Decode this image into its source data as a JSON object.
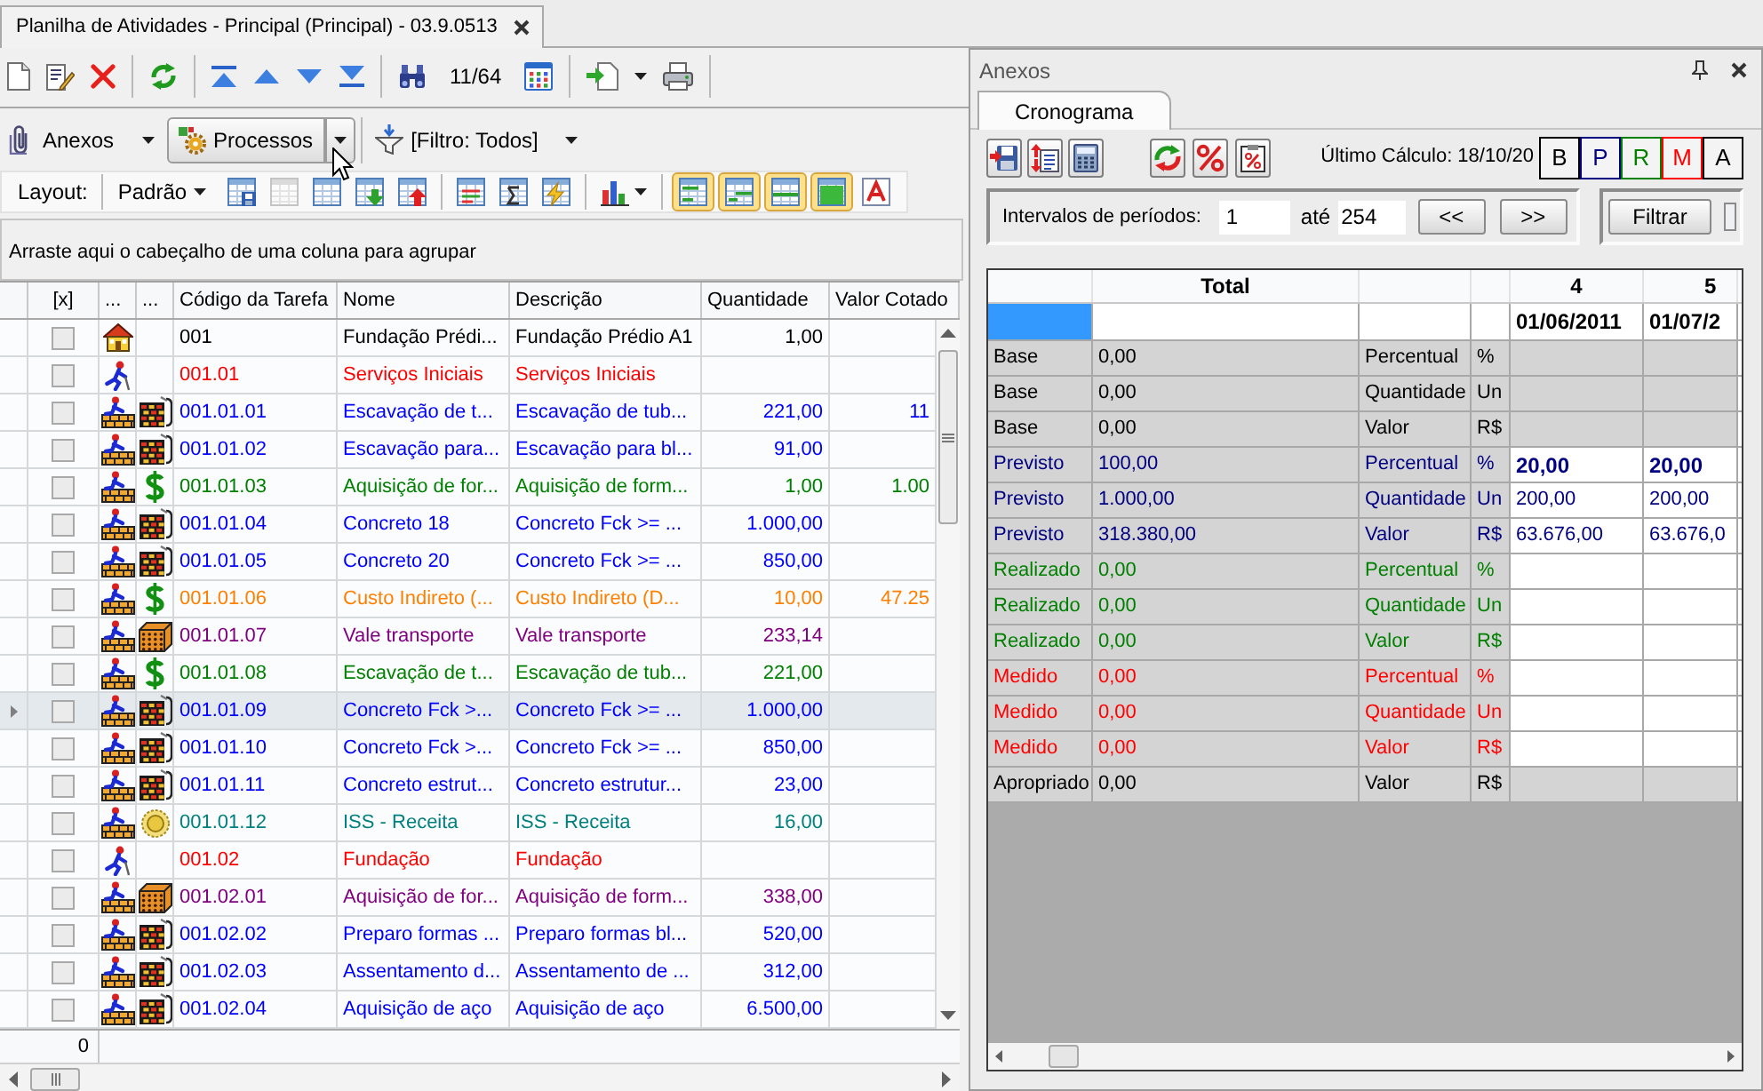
{
  "tab": {
    "title": "Planilha de Atividades - Principal (Principal) - 03.9.0513"
  },
  "toolbar": {
    "record_counter": "11/64"
  },
  "action_bar": {
    "attachments": "Anexos",
    "processes": "Processos",
    "filter": "[Filtro: Todos]"
  },
  "layout_bar": {
    "label": "Layout:",
    "preset": "Padrão",
    "buttons": [
      {
        "on": false,
        "disabled": false
      },
      {
        "on": false,
        "disabled": true
      },
      {
        "on": false,
        "disabled": false
      },
      {
        "on": false,
        "disabled": false
      },
      {
        "on": false,
        "disabled": false
      },
      {
        "on": false,
        "disabled": false
      },
      {
        "on": false,
        "disabled": false
      },
      {
        "on": false,
        "disabled": false
      },
      {
        "on": false,
        "disabled": false
      },
      {
        "on": true,
        "disabled": false
      },
      {
        "on": true,
        "disabled": false
      },
      {
        "on": true,
        "disabled": false
      },
      {
        "on": true,
        "disabled": false
      },
      {
        "on": false,
        "disabled": false
      }
    ]
  },
  "group_panel": {
    "hint": "Arraste aqui o cabeçalho de uma coluna para agrupar"
  },
  "table": {
    "columns": [
      "[x]",
      "...",
      "...",
      "Código da Tarefa",
      "Nome",
      "Descrição",
      "Quantidade",
      "Valor Cotado"
    ],
    "rows": [
      {
        "code": "001",
        "name": "Fundação Prédi...",
        "description": "Fundação Prédio A1",
        "quantity": "1,00",
        "color": "#000000",
        "kind": "project",
        "checked": false,
        "selected": false
      },
      {
        "code": "001.01",
        "name": "Serviços Iniciais",
        "description": "Serviços Iniciais",
        "color": "#ff0000",
        "kind": "stage",
        "checked": false,
        "selected": false
      },
      {
        "code": "001.01.01",
        "name": "Escavação de t...",
        "description": "Escavação de tub...",
        "quantity": "221,00",
        "quoted_value": "11",
        "color": "#0000ff",
        "kind": "task",
        "resource": {
          "kind": "service"
        },
        "checked": false,
        "selected": false
      },
      {
        "code": "001.01.02",
        "name": "Escavação para...",
        "description": "Escavação para bl...",
        "quantity": "91,00",
        "color": "#0000ff",
        "kind": "task",
        "resource": {
          "kind": "service"
        },
        "checked": false,
        "selected": false
      },
      {
        "code": "001.01.03",
        "name": "Aquisição de for...",
        "description": "Aquisição de form...",
        "quantity": "1,00",
        "quoted_value": "1.00",
        "color": "#008000",
        "kind": "task",
        "resource": {
          "kind": "cost"
        },
        "checked": false,
        "selected": false
      },
      {
        "code": "001.01.04",
        "name": "Concreto 18",
        "description": "Concreto Fck >= ...",
        "quantity": "1.000,00",
        "color": "#0000ff",
        "kind": "task",
        "resource": {
          "kind": "service"
        },
        "checked": false,
        "selected": false
      },
      {
        "code": "001.01.05",
        "name": "Concreto 20",
        "description": "Concreto Fck >= ...",
        "quantity": "850,00",
        "color": "#0000ff",
        "kind": "task",
        "resource": {
          "kind": "service"
        },
        "checked": false,
        "selected": false
      },
      {
        "code": "001.01.06",
        "name": "Custo Indireto (...",
        "description": "Custo Indireto (D...",
        "quantity": "10,00",
        "quoted_value": "47.25",
        "color": "#ff8000",
        "kind": "task",
        "resource": {
          "kind": "cost"
        },
        "checked": false,
        "selected": false
      },
      {
        "code": "001.01.07",
        "name": "Vale transporte",
        "description": "Vale transporte",
        "quantity": "233,14",
        "color": "#800080",
        "kind": "task",
        "resource": {
          "kind": "material"
        },
        "checked": false,
        "selected": false
      },
      {
        "code": "001.01.08",
        "name": "Escavação de t...",
        "description": "Escavação de tub...",
        "quantity": "221,00",
        "color": "#008000",
        "kind": "task",
        "resource": {
          "kind": "cost"
        },
        "checked": false,
        "selected": false
      },
      {
        "code": "001.01.09",
        "name": "Concreto Fck >...",
        "description": "Concreto Fck >= ...",
        "quantity": "1.000,00",
        "color": "#0000ff",
        "kind": "task",
        "resource": {
          "kind": "service"
        },
        "checked": false,
        "selected": true
      },
      {
        "code": "001.01.10",
        "name": "Concreto Fck >...",
        "description": "Concreto Fck >= ...",
        "quantity": "850,00",
        "color": "#0000ff",
        "kind": "task",
        "resource": {
          "kind": "service"
        },
        "checked": false,
        "selected": false
      },
      {
        "code": "001.01.11",
        "name": "Concreto estrut...",
        "description": "Concreto estrutur...",
        "quantity": "23,00",
        "color": "#0000ff",
        "kind": "task",
        "resource": {
          "kind": "service"
        },
        "checked": false,
        "selected": false
      },
      {
        "code": "001.01.12",
        "name": "ISS - Receita",
        "description": "ISS - Receita",
        "quantity": "16,00",
        "color": "#008080",
        "kind": "task",
        "resource": {
          "kind": "tax"
        },
        "checked": false,
        "selected": false
      },
      {
        "code": "001.02",
        "name": "Fundação",
        "description": "Fundação",
        "color": "#ff0000",
        "kind": "stage",
        "checked": false,
        "selected": false
      },
      {
        "code": "001.02.01",
        "name": "Aquisição de for...",
        "description": "Aquisição de form...",
        "quantity": "338,00",
        "color": "#800080",
        "kind": "task",
        "resource": {
          "kind": "material"
        },
        "checked": false,
        "selected": false
      },
      {
        "code": "001.02.02",
        "name": "Preparo formas ...",
        "description": "Preparo formas bl...",
        "quantity": "520,00",
        "color": "#0000ff",
        "kind": "task",
        "resource": {
          "kind": "service"
        },
        "checked": false,
        "selected": false
      },
      {
        "code": "001.02.03",
        "name": "Assentamento d...",
        "description": "Assentamento de ...",
        "quantity": "312,00",
        "color": "#0000ff",
        "kind": "task",
        "resource": {
          "kind": "service"
        },
        "checked": false,
        "selected": false
      },
      {
        "code": "001.02.04",
        "name": "Aquisição de aço",
        "description": "Aquisição de aço",
        "quantity": "6.500,00",
        "color": "#0000ff",
        "kind": "task",
        "resource": {
          "kind": "service"
        },
        "checked": false,
        "selected": false
      }
    ],
    "summary": "0"
  },
  "side_panel": {
    "title": "Anexos",
    "tabs": [
      {
        "label": "Cronograma",
        "selected": true
      }
    ],
    "last_calculation": "Último Cálculo: 18/10/20",
    "series_buttons": [
      {
        "label": "B",
        "color": "#000000"
      },
      {
        "label": "P",
        "color": "#000080"
      },
      {
        "label": "R",
        "color": "#008000"
      },
      {
        "label": "M",
        "color": "#ff0000"
      },
      {
        "label": "A",
        "color": "#000000"
      }
    ],
    "interval": {
      "label": "Intervalos de períodos:",
      "from": "1",
      "to_label": "até",
      "to": "254",
      "previous": "<<",
      "next": ">>"
    },
    "filter_button": "Filtrar",
    "schedule": {
      "total_header": "Total",
      "periods": [
        {
          "number": "4",
          "date": "01/06/2011"
        },
        {
          "number": "5",
          "date": "01/07/2"
        }
      ],
      "rows": [
        {
          "series": "Base",
          "total": "0,00",
          "measure": "Percentual",
          "unit": "%",
          "color": "#000000",
          "editable": false
        },
        {
          "series": "Base",
          "total": "0,00",
          "measure": "Quantidade",
          "unit": "Un",
          "color": "#000000",
          "editable": false
        },
        {
          "series": "Base",
          "total": "0,00",
          "measure": "Valor",
          "unit": "R$",
          "color": "#000000",
          "editable": false
        },
        {
          "series": "Previsto",
          "total": "100,00",
          "measure": "Percentual",
          "unit": "%",
          "color": "#000080",
          "editable": true,
          "bold": true,
          "values": [
            "20,00",
            "20,00"
          ]
        },
        {
          "series": "Previsto",
          "total": "1.000,00",
          "measure": "Quantidade",
          "unit": "Un",
          "color": "#000080",
          "editable": true,
          "bold": false,
          "values": [
            "200,00",
            "200,00"
          ]
        },
        {
          "series": "Previsto",
          "total": "318.380,00",
          "measure": "Valor",
          "unit": "R$",
          "color": "#000080",
          "editable": true,
          "bold": false,
          "values": [
            "63.676,00",
            "63.676,0"
          ]
        },
        {
          "series": "Realizado",
          "total": "0,00",
          "measure": "Percentual",
          "unit": "%",
          "color": "#008000",
          "editable": true
        },
        {
          "series": "Realizado",
          "total": "0,00",
          "measure": "Quantidade",
          "unit": "Un",
          "color": "#008000",
          "editable": true
        },
        {
          "series": "Realizado",
          "total": "0,00",
          "measure": "Valor",
          "unit": "R$",
          "color": "#008000",
          "editable": true
        },
        {
          "series": "Medido",
          "total": "0,00",
          "measure": "Percentual",
          "unit": "%",
          "color": "#ff0000",
          "editable": true
        },
        {
          "series": "Medido",
          "total": "0,00",
          "measure": "Quantidade",
          "unit": "Un",
          "color": "#ff0000",
          "editable": true
        },
        {
          "series": "Medido",
          "total": "0,00",
          "measure": "Valor",
          "unit": "R$",
          "color": "#ff0000",
          "editable": true
        },
        {
          "series": "Apropriado",
          "total": "0,00",
          "measure": "Valor",
          "unit": "R$",
          "color": "#000000",
          "editable": false
        }
      ]
    }
  }
}
